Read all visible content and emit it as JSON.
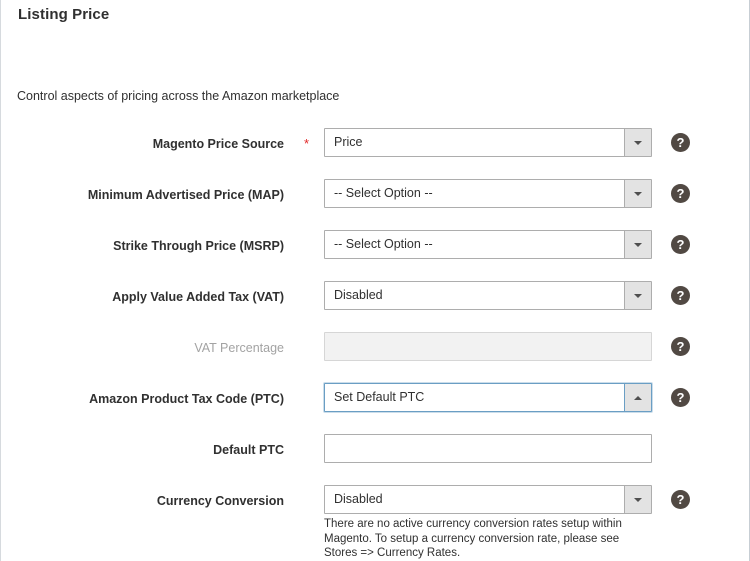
{
  "section": {
    "title": "Listing Price",
    "description": "Control aspects of pricing across the Amazon marketplace"
  },
  "icons": {
    "help": "?",
    "required_marker": "*"
  },
  "colors": {
    "required_asterisk": "#e22626",
    "help_icon_bg": "#514943",
    "focus_border": "#6a9ec4",
    "field_border": "#adadad",
    "disabled_bg": "#f2f2f2",
    "text": "#303030"
  },
  "fields": [
    {
      "id": "magento-price-source",
      "label": "Magento Price Source",
      "required": true,
      "type": "select",
      "value": "Price",
      "state": "default",
      "arrow": "down",
      "help": true
    },
    {
      "id": "minimum-advertised-price",
      "label": "Minimum Advertised Price (MAP)",
      "required": false,
      "type": "select",
      "value": "-- Select Option --",
      "state": "default",
      "arrow": "down",
      "help": true
    },
    {
      "id": "strike-through-price",
      "label": "Strike Through Price (MSRP)",
      "required": false,
      "type": "select",
      "value": "-- Select Option --",
      "state": "default",
      "arrow": "down",
      "help": true
    },
    {
      "id": "apply-vat",
      "label": "Apply Value Added Tax (VAT)",
      "required": false,
      "type": "select",
      "value": "Disabled",
      "state": "default",
      "arrow": "down",
      "help": true
    },
    {
      "id": "vat-percentage",
      "label": "VAT Percentage",
      "required": false,
      "type": "text",
      "value": "",
      "placeholder": "",
      "state": "disabled",
      "help": true
    },
    {
      "id": "amazon-product-tax-code",
      "label": "Amazon Product Tax Code (PTC)",
      "required": false,
      "type": "select",
      "value": "Set Default PTC",
      "state": "focused",
      "arrow": "up",
      "help": true
    },
    {
      "id": "default-ptc",
      "label": "Default PTC",
      "required": false,
      "type": "text",
      "value": "",
      "placeholder": "",
      "state": "default",
      "help": false
    },
    {
      "id": "currency-conversion",
      "label": "Currency Conversion",
      "required": false,
      "type": "select",
      "value": "Disabled",
      "state": "default",
      "arrow": "down",
      "help": true,
      "note": "There are no active currency conversion rates setup within Magento. To setup a currency conversion rate, please see Stores => Currency Rates."
    }
  ]
}
